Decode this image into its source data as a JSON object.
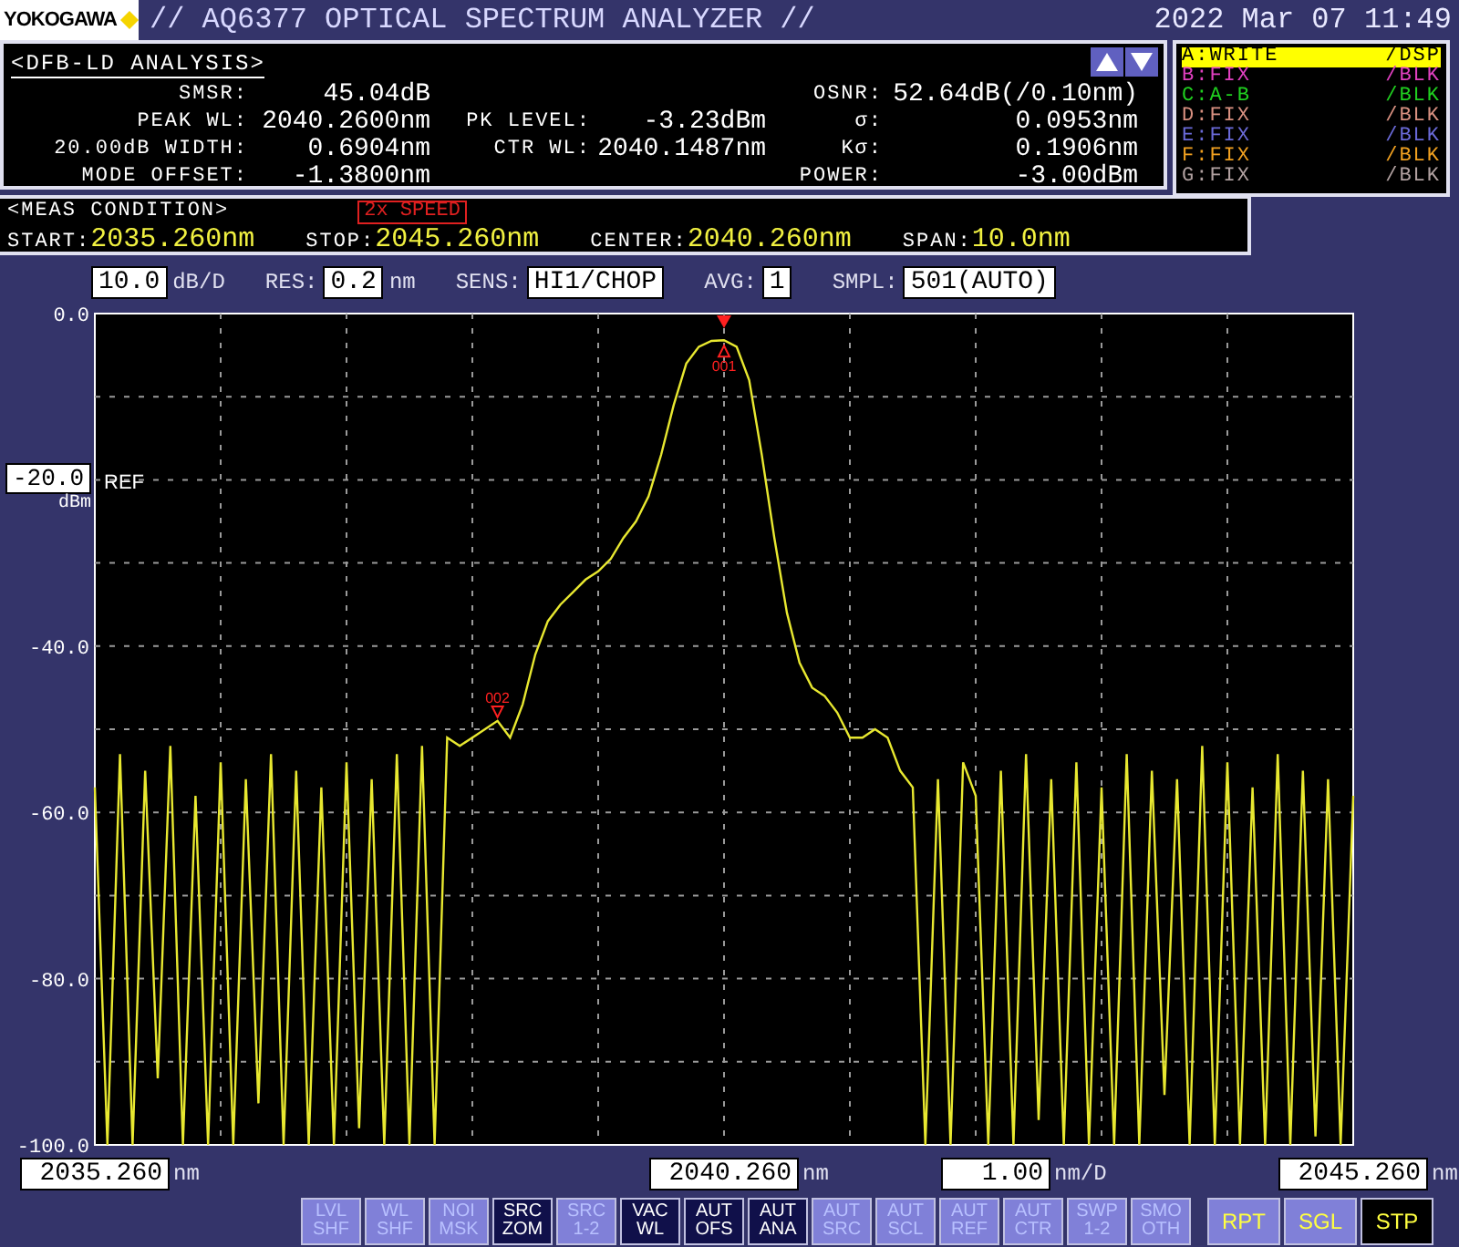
{
  "header": {
    "logo": "YOKOGAWA",
    "title": "// AQ6377 OPTICAL SPECTRUM ANALYZER //",
    "datetime": "2022 Mar 07 11:49"
  },
  "analysis": {
    "title": "<DFB-LD ANALYSIS>",
    "left": [
      {
        "label": "SMSR:",
        "value": "45.04dB"
      },
      {
        "label": "PEAK WL:",
        "value": "2040.2600nm"
      },
      {
        "label": "20.00dB WIDTH:",
        "value": "0.6904nm"
      },
      {
        "label": "MODE OFFSET:",
        "value": "-1.3800nm"
      }
    ],
    "middle": [
      {
        "label": "PK LEVEL:",
        "value": "-3.23dBm"
      },
      {
        "label": "CTR WL:",
        "value": "2040.1487nm"
      }
    ],
    "right": [
      {
        "label": "OSNR:",
        "value": "52.64dB(/0.10nm)"
      },
      {
        "label": "σ:",
        "value": "0.0953nm"
      },
      {
        "label": "Kσ:",
        "value": "0.1906nm"
      },
      {
        "label": "POWER:",
        "value": "-3.00dBm"
      }
    ]
  },
  "traces": [
    {
      "label": "A:WRITE",
      "mode": "/DSP",
      "color": "#ffff00",
      "selected": true
    },
    {
      "label": "B:FIX",
      "mode": "/BLK",
      "color": "#e040c0",
      "selected": false
    },
    {
      "label": "C:A-B",
      "mode": "/BLK",
      "color": "#20d020",
      "selected": false
    },
    {
      "label": "D:FIX",
      "mode": "/BLK",
      "color": "#d89080",
      "selected": false
    },
    {
      "label": "E:FIX",
      "mode": "/BLK",
      "color": "#6a6ad8",
      "selected": false
    },
    {
      "label": "F:FIX",
      "mode": "/BLK",
      "color": "#f0a020",
      "selected": false
    },
    {
      "label": "G:FIX",
      "mode": "/BLK",
      "color": "#b0a0a0",
      "selected": false
    }
  ],
  "meas_condition": {
    "title": "<MEAS CONDITION>",
    "badge": "2x SPEED",
    "items": [
      {
        "label": "START:",
        "value": "2035.260nm"
      },
      {
        "label": "STOP:",
        "value": "2045.260nm"
      },
      {
        "label": "CENTER:",
        "value": "2040.260nm"
      },
      {
        "label": "SPAN:",
        "value": "10.0nm"
      }
    ]
  },
  "settings": [
    {
      "value": "10.0",
      "unit": "dB/D"
    },
    {
      "label": "RES:",
      "value": "0.2",
      "unit": "nm"
    },
    {
      "label": "SENS:",
      "value": "HI1/CHOP"
    },
    {
      "label": "AVG:",
      "value": "1"
    },
    {
      "label": "SMPL:",
      "value": "501(AUTO)"
    }
  ],
  "ref_level": {
    "value": "-20.0",
    "unit": "dBm",
    "label": "REF"
  },
  "chart_data": {
    "type": "line",
    "xlim": [
      2035.26,
      2045.26
    ],
    "ylim": [
      -100,
      0
    ],
    "grid": true,
    "xticks": [
      {
        "value": 2035.26,
        "label": "2035.260"
      },
      {
        "value": 2040.26,
        "label": "2040.260"
      },
      {
        "value": 2045.26,
        "label": "2045.260"
      }
    ],
    "yticks": [
      {
        "value": 0,
        "label": "0.0"
      },
      {
        "value": -40,
        "label": "-40.0"
      },
      {
        "value": -60,
        "label": "-60.0"
      },
      {
        "value": -80,
        "label": "-80.0"
      },
      {
        "value": -100,
        "label": "-100.0"
      }
    ],
    "x": [
      2035.26,
      2035.36,
      2035.46,
      2035.56,
      2035.66,
      2035.76,
      2035.86,
      2035.96,
      2036.06,
      2036.16,
      2036.26,
      2036.36,
      2036.46,
      2036.56,
      2036.66,
      2036.76,
      2036.86,
      2036.96,
      2037.06,
      2037.16,
      2037.26,
      2037.36,
      2037.46,
      2037.56,
      2037.66,
      2037.76,
      2037.86,
      2037.96,
      2038.06,
      2038.16,
      2038.26,
      2038.36,
      2038.46,
      2038.56,
      2038.66,
      2038.76,
      2038.86,
      2038.96,
      2039.06,
      2039.16,
      2039.26,
      2039.36,
      2039.46,
      2039.56,
      2039.66,
      2039.76,
      2039.86,
      2039.96,
      2040.06,
      2040.16,
      2040.26,
      2040.36,
      2040.46,
      2040.56,
      2040.66,
      2040.76,
      2040.86,
      2040.96,
      2041.06,
      2041.16,
      2041.26,
      2041.36,
      2041.46,
      2041.56,
      2041.66,
      2041.76,
      2041.86,
      2041.96,
      2042.06,
      2042.16,
      2042.26,
      2042.36,
      2042.46,
      2042.56,
      2042.66,
      2042.76,
      2042.86,
      2042.96,
      2043.06,
      2043.16,
      2043.26,
      2043.36,
      2043.46,
      2043.56,
      2043.66,
      2043.76,
      2043.86,
      2043.96,
      2044.06,
      2044.16,
      2044.26,
      2044.36,
      2044.46,
      2044.56,
      2044.66,
      2044.76,
      2044.86,
      2044.96,
      2045.06,
      2045.16,
      2045.26
    ],
    "series": [
      {
        "color": "#e8e830",
        "values": [
          -57,
          -100,
          -53,
          -100,
          -55,
          -92,
          -52,
          -100,
          -58,
          -100,
          -54,
          -100,
          -56,
          -95,
          -53,
          -100,
          -55,
          -100,
          -57,
          -100,
          -54,
          -98,
          -56,
          -100,
          -53,
          -100,
          -52,
          -100,
          -51,
          -52,
          -51,
          -50,
          -49,
          -51,
          -47,
          -41,
          -37,
          -35,
          -33.5,
          -32,
          -31,
          -29.5,
          -27,
          -25,
          -22,
          -17,
          -11,
          -6,
          -4,
          -3.3,
          -3.2,
          -4,
          -8,
          -17,
          -27,
          -36,
          -42,
          -45,
          -46,
          -48,
          -51,
          -51,
          -50,
          -51,
          -55,
          -57,
          -100,
          -56,
          -100,
          -54,
          -58,
          -100,
          -55,
          -100,
          -53,
          -97,
          -56,
          -100,
          -54,
          -100,
          -57,
          -100,
          -53,
          -100,
          -55,
          -94,
          -56,
          -100,
          -52,
          -100,
          -54,
          -100,
          -57,
          -100,
          -53,
          -100,
          -55,
          -99,
          -56,
          -100,
          -58
        ]
      }
    ],
    "annotations": [
      {
        "text": "001",
        "x": 2040.26,
        "y": -3.2
      },
      {
        "text": "002",
        "x": 2038.46,
        "y": -49
      }
    ]
  },
  "x_axis": {
    "tick_units": [
      "nm",
      "nm",
      "nm"
    ],
    "scale": "1.00",
    "scale_unit": "nm/D"
  },
  "softkeys": [
    {
      "lines": [
        "LVL",
        "SHF"
      ],
      "on": false
    },
    {
      "lines": [
        "WL",
        "SHF"
      ],
      "on": false
    },
    {
      "lines": [
        "NOI",
        "MSK"
      ],
      "on": false
    },
    {
      "lines": [
        "SRC",
        "ZOM"
      ],
      "on": true
    },
    {
      "lines": [
        "SRC",
        "1-2"
      ],
      "on": false
    },
    {
      "lines": [
        "VAC",
        "WL"
      ],
      "on": true
    },
    {
      "lines": [
        "AUT",
        "OFS"
      ],
      "on": true
    },
    {
      "lines": [
        "AUT",
        "ANA"
      ],
      "on": true
    },
    {
      "lines": [
        "AUT",
        "SRC"
      ],
      "on": false
    },
    {
      "lines": [
        "AUT",
        "SCL"
      ],
      "on": false
    },
    {
      "lines": [
        "AUT",
        "REF"
      ],
      "on": false
    },
    {
      "lines": [
        "AUT",
        "CTR"
      ],
      "on": false
    },
    {
      "lines": [
        "SWP",
        "1-2"
      ],
      "on": false
    },
    {
      "lines": [
        "SMO",
        "OTH"
      ],
      "on": false
    }
  ],
  "sweep_buttons": [
    {
      "label": "RPT",
      "selected": false
    },
    {
      "label": "SGL",
      "selected": false
    },
    {
      "label": "STP",
      "selected": true
    }
  ]
}
